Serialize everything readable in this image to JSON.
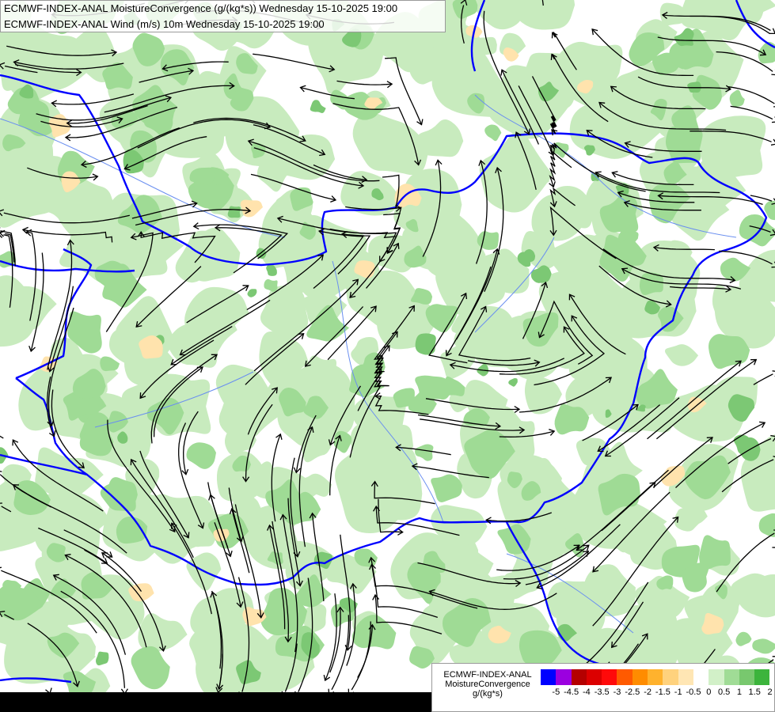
{
  "header": {
    "line1": "ECMWF-INDEX-ANAL MoistureConvergence (g/(kg*s)) Wednesday 15-10-2025 19:00",
    "line2": "ECMWF-INDEX-ANAL Wind (m/s) 10m Wednesday 15-10-2025 19:00"
  },
  "legend": {
    "model": "ECMWF-INDEX-ANAL",
    "parameter": "MoistureConvergence",
    "unit": "g/(kg*s)",
    "swatches": [
      {
        "color": "#0000ff"
      },
      {
        "color": "#9b00e0"
      },
      {
        "color": "#b40000"
      },
      {
        "color": "#dc0000"
      },
      {
        "color": "#ff0a0a"
      },
      {
        "color": "#ff5a00"
      },
      {
        "color": "#ff8c00"
      },
      {
        "color": "#ffb22d"
      },
      {
        "color": "#ffd27d"
      },
      {
        "color": "#ffe6b4"
      },
      {
        "color": "#ffffff"
      },
      {
        "color": "#d2f0c8"
      },
      {
        "color": "#a0dc96"
      },
      {
        "color": "#78c86e"
      },
      {
        "color": "#3cb43c"
      }
    ],
    "ticks": [
      "-5",
      "-4.5",
      "-4",
      "-3.5",
      "-3",
      "-2.5",
      "-2",
      "-1.5",
      "-1",
      "-0.5",
      "0",
      "0.5",
      "1",
      "1.5",
      "2"
    ]
  },
  "map": {
    "colors": {
      "background": "#ffffff",
      "green_light": "#c8ebbe",
      "green_mid": "#9fdb95",
      "green_dark": "#7cc874",
      "orange_pale": "#ffe3ad",
      "border": "#0000ff",
      "river": "#6a8ff0",
      "streamline": "#000000"
    }
  }
}
